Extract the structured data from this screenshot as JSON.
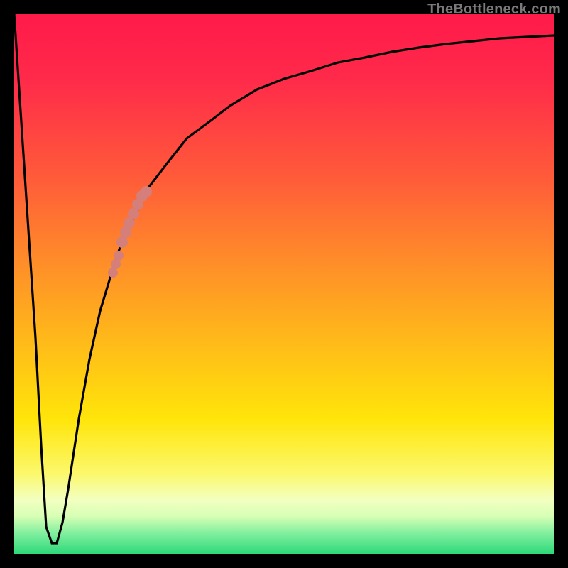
{
  "attribution": "TheBottleneck.com",
  "chart_data": {
    "type": "line",
    "title": "",
    "xlabel": "",
    "ylabel": "",
    "xlim": [
      0,
      100
    ],
    "ylim": [
      0,
      100
    ],
    "grid": false,
    "series": [
      {
        "name": "bottleneck-curve",
        "x": [
          0,
          2,
          4,
          5,
          6,
          7,
          8,
          9,
          10,
          12,
          14,
          16,
          18,
          20,
          22,
          25,
          28,
          32,
          36,
          40,
          45,
          50,
          55,
          60,
          65,
          70,
          75,
          80,
          85,
          90,
          95,
          100
        ],
        "y": [
          100,
          70,
          40,
          20,
          5,
          2,
          2,
          5,
          12,
          25,
          36,
          45,
          52,
          58,
          62,
          68,
          72,
          77,
          80,
          83,
          86,
          88,
          89.5,
          91,
          92,
          93,
          93.8,
          94.5,
          95,
          95.5,
          95.8,
          96
        ]
      }
    ],
    "highlights": [
      {
        "name": "highlight-lower",
        "color": "#d47f7a",
        "x_range": [
          18.3,
          19.3
        ],
        "y_range": [
          52.1,
          55.3
        ]
      },
      {
        "name": "highlight-upper",
        "color": "#d47f7a",
        "x_range": [
          20.0,
          24.5
        ],
        "y_range": [
          57.7,
          67.1
        ]
      }
    ]
  }
}
